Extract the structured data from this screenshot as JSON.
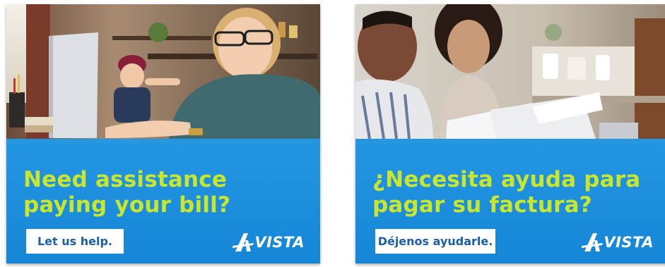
{
  "ads": [
    {
      "headline_line1": "Need assistance",
      "headline_line2": "paying your bill?",
      "cta_label": "Let us help.",
      "logo_text": "VISTA",
      "photo_subject": "mother-and-child-at-laptop-photo"
    },
    {
      "headline_line1": "¿Necesita ayuda para",
      "headline_line2": "pagar su factura?",
      "cta_label": "Déjenos ayudarle.",
      "logo_text": "VISTA",
      "photo_subject": "couple-reviewing-bills-photo"
    }
  ],
  "colors": {
    "panel_blue": "#1a8fdc",
    "headline_green": "#c8e62e",
    "cta_text_blue": "#1a5fa8",
    "logo_white": "#ffffff"
  }
}
